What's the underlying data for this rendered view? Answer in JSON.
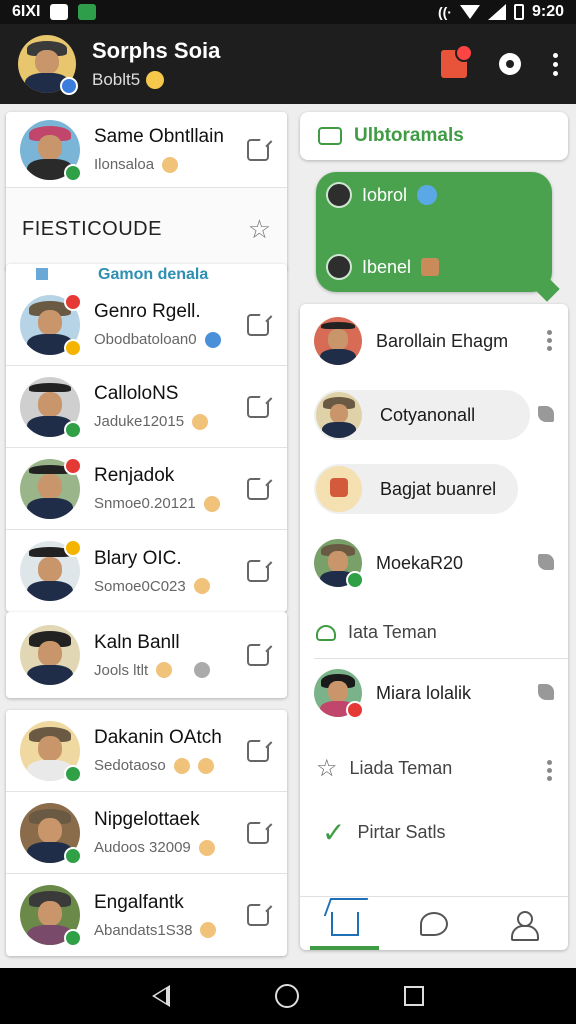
{
  "statusbar": {
    "left_text": "6IXI",
    "time": "9:20"
  },
  "header": {
    "title": "Sorphs Soia",
    "subtitle": "Boblt5"
  },
  "left": {
    "top_contact": {
      "name": "Same Obntllain",
      "sub": "Ilonsaloa"
    },
    "tag": {
      "label": "FIESTICOUDE"
    },
    "group": {
      "title": "Gamon denala",
      "contacts": [
        {
          "name": "Genro Rgell.",
          "sub": "Obodbatoloan0"
        },
        {
          "name": "CalloloNS",
          "sub": "Jaduke12015"
        },
        {
          "name": "Renjadok",
          "sub": "Snmoe0.20121"
        },
        {
          "name": "Blary OIC.",
          "sub": "Somoe0C023"
        }
      ]
    },
    "single_contact": {
      "name": "Kaln Banll",
      "sub": "Jools ltlt"
    },
    "bottom_contacts": [
      {
        "name": "Dakanin OAtch",
        "sub": "Sedotaoso"
      },
      {
        "name": "Nipgelottaek",
        "sub": "Audoos 32009"
      },
      {
        "name": "Engalfantk",
        "sub": "Abandats1S38"
      }
    ]
  },
  "right": {
    "banner": {
      "label": "Ulbtoramals"
    },
    "bubble": {
      "line1": "Iobrol",
      "line2": "Ibenel"
    },
    "people": [
      {
        "name": "Barollain Ehagm"
      },
      {
        "name": "Cotyanonall"
      },
      {
        "name": "Bagjat buanrel"
      },
      {
        "name": "MoekaR20"
      }
    ],
    "link_teman": "Iata Teman",
    "person_after": {
      "name": "Miara lolalik"
    },
    "liada": "Liada Teman",
    "pirtar": "Pirtar Satls"
  },
  "colors": {
    "accent_green": "#3f9c44",
    "bubble_green": "#4aa24f",
    "header_bg": "#1e1e1e",
    "link_blue": "#2e8fb3"
  }
}
